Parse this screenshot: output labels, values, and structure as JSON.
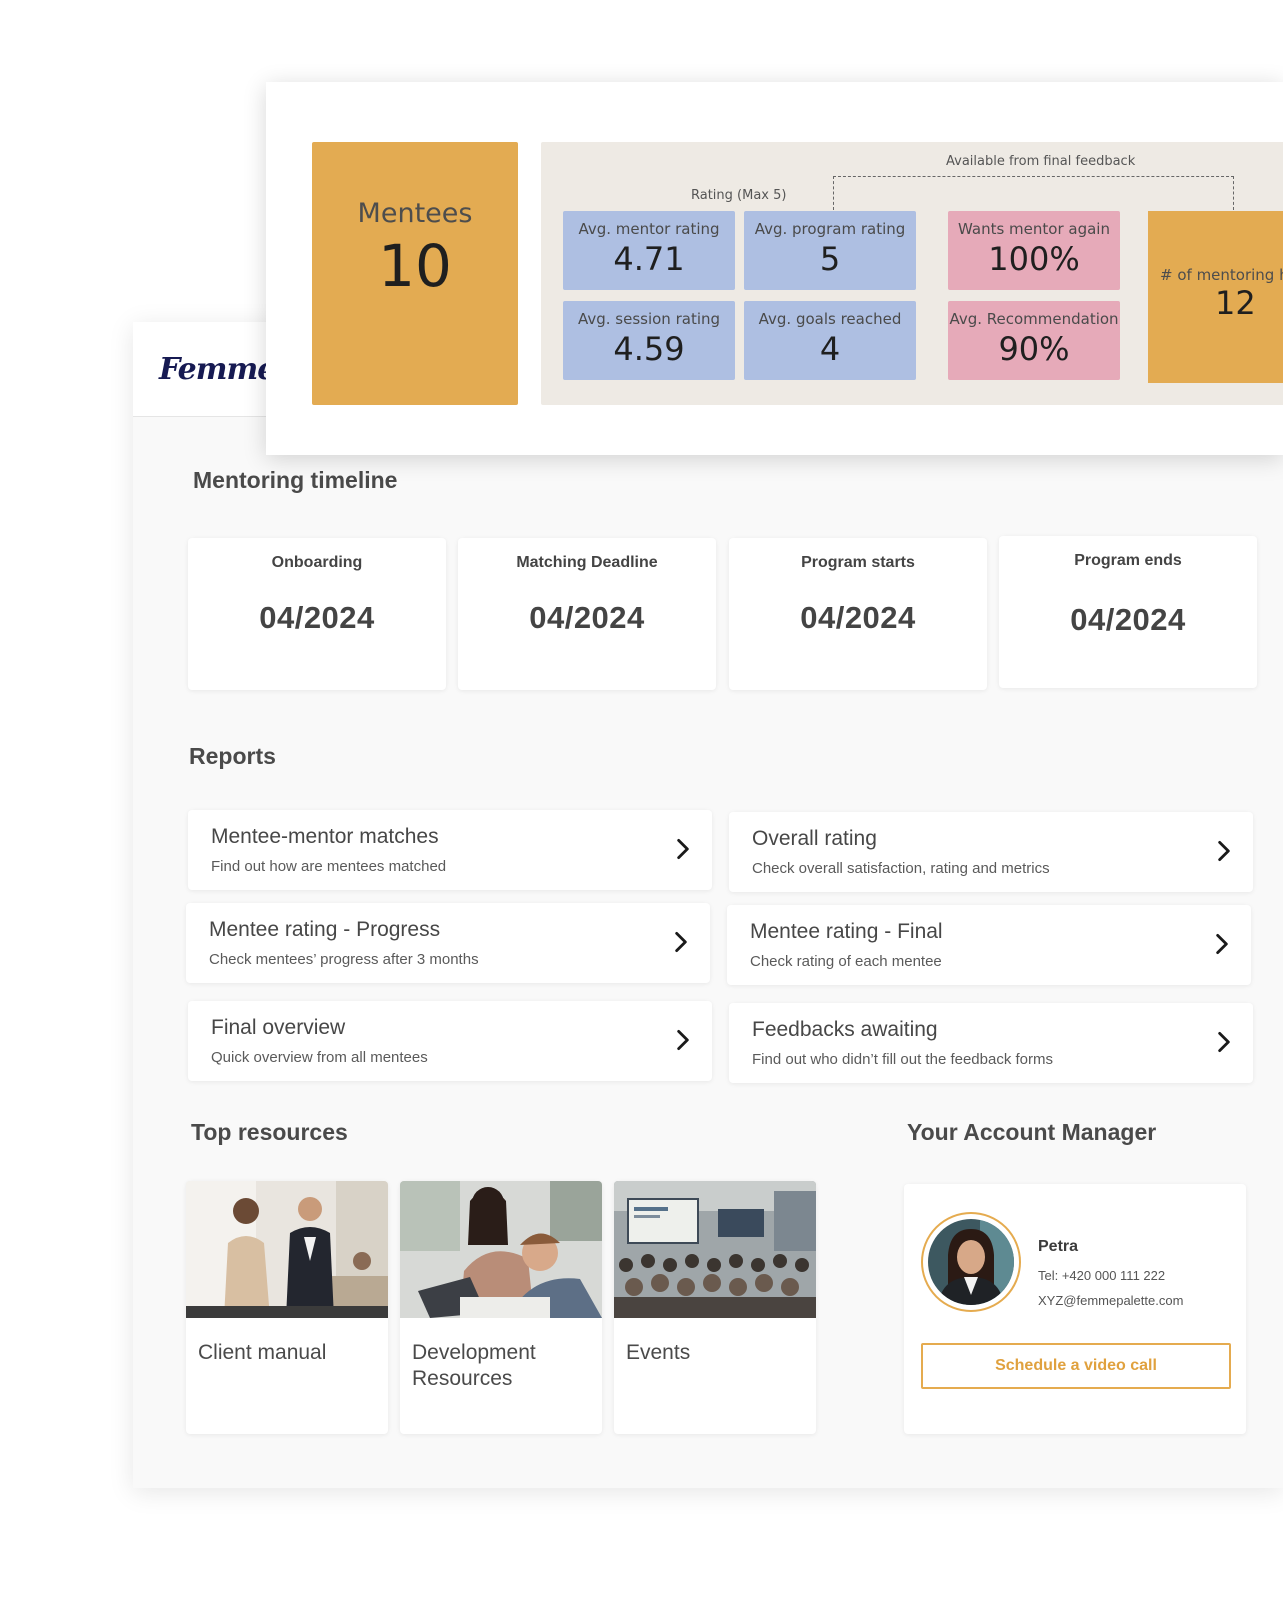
{
  "brand": {
    "logo_text": "Femme"
  },
  "stats": {
    "mentees_label": "Mentees",
    "mentees_value": "10",
    "feedback_group_label": "Available from final feedback",
    "rating_group_label": "Rating (Max 5)",
    "metrics": [
      {
        "label": "Avg. mentor rating",
        "value": "4.71"
      },
      {
        "label": "Avg. program rating",
        "value": "5"
      },
      {
        "label": "Avg. session rating",
        "value": "4.59"
      },
      {
        "label": "Avg. goals reached",
        "value": "4"
      },
      {
        "label": "Wants mentor again",
        "value": "100%"
      },
      {
        "label": "Avg. Recommendation",
        "value": "90%"
      }
    ],
    "hours_label": "# of mentoring ho",
    "hours_value": "12"
  },
  "timeline": {
    "title": "Mentoring timeline",
    "items": [
      {
        "label": "Onboarding",
        "date": "04/2024"
      },
      {
        "label": "Matching Deadline",
        "date": "04/2024"
      },
      {
        "label": "Program starts",
        "date": "04/2024"
      },
      {
        "label": "Program ends",
        "date": "04/2024"
      }
    ]
  },
  "reports": {
    "title": "Reports",
    "items": [
      {
        "title": "Mentee-mentor matches",
        "subtitle": "Find out how are mentees matched"
      },
      {
        "title": "Overall rating",
        "subtitle": "Check overall satisfaction, rating and metrics"
      },
      {
        "title": "Mentee rating - Progress",
        "subtitle": "Check mentees’ progress after 3 months"
      },
      {
        "title": "Mentee rating - Final",
        "subtitle": "Check rating of each mentee"
      },
      {
        "title": "Final overview",
        "subtitle": "Quick overview from all mentees"
      },
      {
        "title": "Feedbacks awaiting",
        "subtitle": "Find out who didn’t fill out the feedback forms"
      }
    ]
  },
  "resources": {
    "title": "Top resources",
    "items": [
      {
        "label": "Client manual",
        "image_icon": "business-meeting-photo"
      },
      {
        "label": "Development Resources",
        "image_icon": "workshop-laptop-photo"
      },
      {
        "label": "Events",
        "image_icon": "conference-audience-photo"
      }
    ]
  },
  "account_manager": {
    "title": "Your Account Manager",
    "name": "Petra",
    "tel": "Tel: +420 000 111 222",
    "email": "XYZ@femmepalette.com",
    "button_label": "Schedule a video call"
  },
  "colors": {
    "accent_orange": "#e3ab52",
    "metric_blue": "#aebfe2",
    "metric_pink": "#e6aab9",
    "metrics_bg": "#eeeae4",
    "logo_navy": "#161a52"
  }
}
